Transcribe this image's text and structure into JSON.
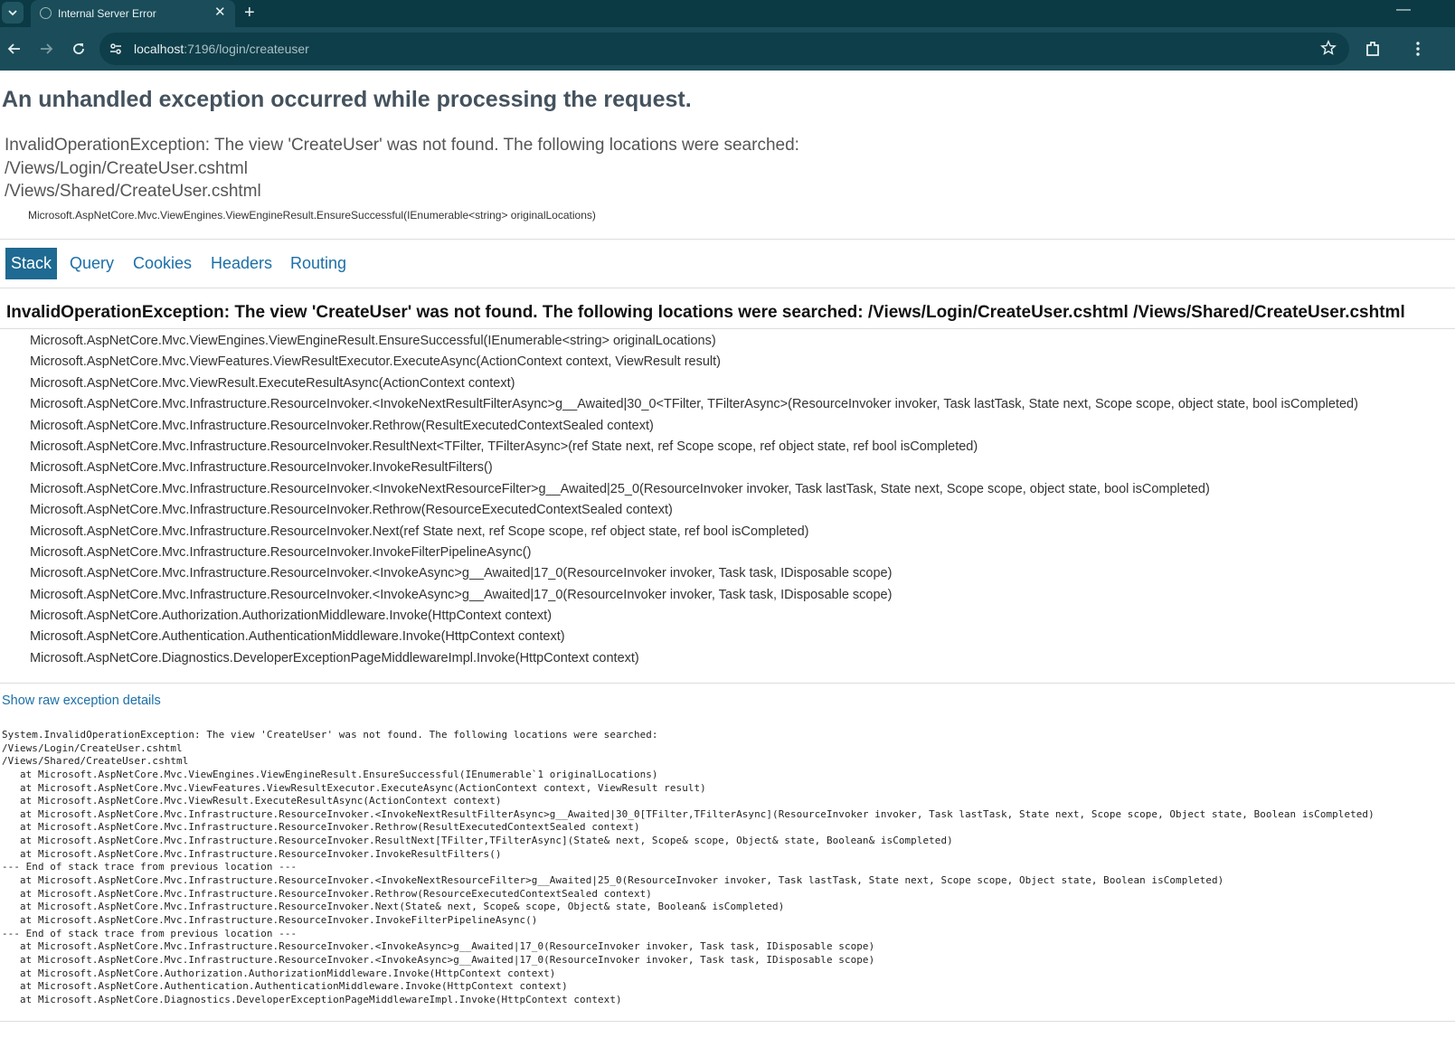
{
  "browser": {
    "tab_title": "Internal Server Error",
    "url_host": "localhost",
    "url_rest": ":7196/login/createuser"
  },
  "page": {
    "heading": "An unhandled exception occurred while processing the request.",
    "title_error": "InvalidOperationException: The view 'CreateUser' was not found. The following locations were searched:\n/Views/Login/CreateUser.cshtml\n/Views/Shared/CreateUser.cshtml",
    "location": "Microsoft.AspNetCore.Mvc.ViewEngines.ViewEngineResult.EnsureSuccessful(IEnumerable<string> originalLocations)",
    "tabs": [
      "Stack",
      "Query",
      "Cookies",
      "Headers",
      "Routing"
    ],
    "active_tab": "Stack",
    "stack_heading": "InvalidOperationException: The view 'CreateUser' was not found. The following locations were searched: /Views/Login/CreateUser.cshtml /Views/Shared/CreateUser.cshtml",
    "frames": [
      "Microsoft.AspNetCore.Mvc.ViewEngines.ViewEngineResult.EnsureSuccessful(IEnumerable<string> originalLocations)",
      "Microsoft.AspNetCore.Mvc.ViewFeatures.ViewResultExecutor.ExecuteAsync(ActionContext context, ViewResult result)",
      "Microsoft.AspNetCore.Mvc.ViewResult.ExecuteResultAsync(ActionContext context)",
      "Microsoft.AspNetCore.Mvc.Infrastructure.ResourceInvoker.<InvokeNextResultFilterAsync>g__Awaited|30_0<TFilter, TFilterAsync>(ResourceInvoker invoker, Task lastTask, State next, Scope scope, object state, bool isCompleted)",
      "Microsoft.AspNetCore.Mvc.Infrastructure.ResourceInvoker.Rethrow(ResultExecutedContextSealed context)",
      "Microsoft.AspNetCore.Mvc.Infrastructure.ResourceInvoker.ResultNext<TFilter, TFilterAsync>(ref State next, ref Scope scope, ref object state, ref bool isCompleted)",
      "Microsoft.AspNetCore.Mvc.Infrastructure.ResourceInvoker.InvokeResultFilters()",
      "Microsoft.AspNetCore.Mvc.Infrastructure.ResourceInvoker.<InvokeNextResourceFilter>g__Awaited|25_0(ResourceInvoker invoker, Task lastTask, State next, Scope scope, object state, bool isCompleted)",
      "Microsoft.AspNetCore.Mvc.Infrastructure.ResourceInvoker.Rethrow(ResourceExecutedContextSealed context)",
      "Microsoft.AspNetCore.Mvc.Infrastructure.ResourceInvoker.Next(ref State next, ref Scope scope, ref object state, ref bool isCompleted)",
      "Microsoft.AspNetCore.Mvc.Infrastructure.ResourceInvoker.InvokeFilterPipelineAsync()",
      "Microsoft.AspNetCore.Mvc.Infrastructure.ResourceInvoker.<InvokeAsync>g__Awaited|17_0(ResourceInvoker invoker, Task task, IDisposable scope)",
      "Microsoft.AspNetCore.Mvc.Infrastructure.ResourceInvoker.<InvokeAsync>g__Awaited|17_0(ResourceInvoker invoker, Task task, IDisposable scope)",
      "Microsoft.AspNetCore.Authorization.AuthorizationMiddleware.Invoke(HttpContext context)",
      "Microsoft.AspNetCore.Authentication.AuthenticationMiddleware.Invoke(HttpContext context)",
      "Microsoft.AspNetCore.Diagnostics.DeveloperExceptionPageMiddlewareImpl.Invoke(HttpContext context)"
    ],
    "raw_link": "Show raw exception details",
    "raw_details": "System.InvalidOperationException: The view 'CreateUser' was not found. The following locations were searched:\n/Views/Login/CreateUser.cshtml\n/Views/Shared/CreateUser.cshtml\n   at Microsoft.AspNetCore.Mvc.ViewEngines.ViewEngineResult.EnsureSuccessful(IEnumerable`1 originalLocations)\n   at Microsoft.AspNetCore.Mvc.ViewFeatures.ViewResultExecutor.ExecuteAsync(ActionContext context, ViewResult result)\n   at Microsoft.AspNetCore.Mvc.ViewResult.ExecuteResultAsync(ActionContext context)\n   at Microsoft.AspNetCore.Mvc.Infrastructure.ResourceInvoker.<InvokeNextResultFilterAsync>g__Awaited|30_0[TFilter,TFilterAsync](ResourceInvoker invoker, Task lastTask, State next, Scope scope, Object state, Boolean isCompleted)\n   at Microsoft.AspNetCore.Mvc.Infrastructure.ResourceInvoker.Rethrow(ResultExecutedContextSealed context)\n   at Microsoft.AspNetCore.Mvc.Infrastructure.ResourceInvoker.ResultNext[TFilter,TFilterAsync](State& next, Scope& scope, Object& state, Boolean& isCompleted)\n   at Microsoft.AspNetCore.Mvc.Infrastructure.ResourceInvoker.InvokeResultFilters()\n--- End of stack trace from previous location ---\n   at Microsoft.AspNetCore.Mvc.Infrastructure.ResourceInvoker.<InvokeNextResourceFilter>g__Awaited|25_0(ResourceInvoker invoker, Task lastTask, State next, Scope scope, Object state, Boolean isCompleted)\n   at Microsoft.AspNetCore.Mvc.Infrastructure.ResourceInvoker.Rethrow(ResourceExecutedContextSealed context)\n   at Microsoft.AspNetCore.Mvc.Infrastructure.ResourceInvoker.Next(State& next, Scope& scope, Object& state, Boolean& isCompleted)\n   at Microsoft.AspNetCore.Mvc.Infrastructure.ResourceInvoker.InvokeFilterPipelineAsync()\n--- End of stack trace from previous location ---\n   at Microsoft.AspNetCore.Mvc.Infrastructure.ResourceInvoker.<InvokeAsync>g__Awaited|17_0(ResourceInvoker invoker, Task task, IDisposable scope)\n   at Microsoft.AspNetCore.Mvc.Infrastructure.ResourceInvoker.<InvokeAsync>g__Awaited|17_0(ResourceInvoker invoker, Task task, IDisposable scope)\n   at Microsoft.AspNetCore.Authorization.AuthorizationMiddleware.Invoke(HttpContext context)\n   at Microsoft.AspNetCore.Authentication.AuthenticationMiddleware.Invoke(HttpContext context)\n   at Microsoft.AspNetCore.Diagnostics.DeveloperExceptionPageMiddlewareImpl.Invoke(HttpContext context)"
  },
  "icons": [
    "tab-search-icon",
    "globe-icon",
    "close-icon",
    "plus-icon",
    "minimize-icon",
    "back-arrow-icon",
    "forward-arrow-icon",
    "reload-icon",
    "site-info-icon",
    "star-icon",
    "extensions-icon",
    "menu-icon"
  ],
  "colors": {
    "tabbar": "#0b3a44",
    "toolbar": "#1a4d59",
    "link": "#1b6fa8",
    "active_tab": "#1e6a92",
    "heading": "#44525e"
  }
}
